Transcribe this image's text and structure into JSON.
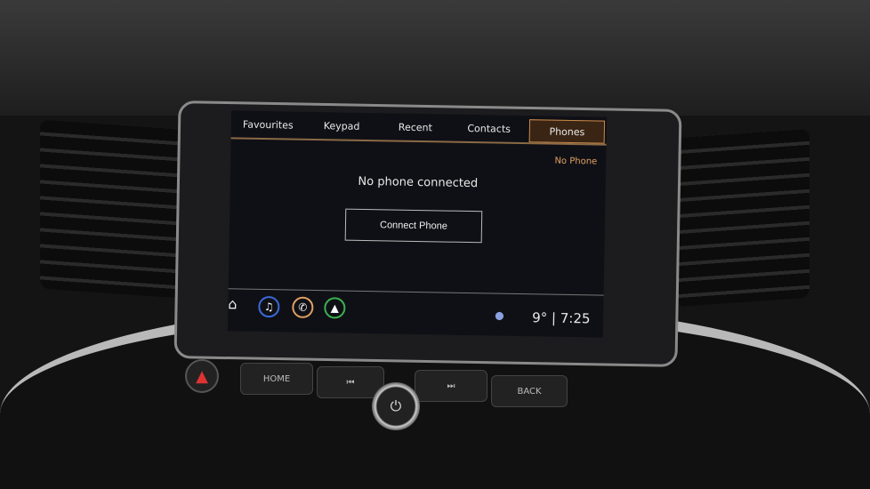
{
  "tabs": [
    {
      "label": "Favourites"
    },
    {
      "label": "Keypad"
    },
    {
      "label": "Recent"
    },
    {
      "label": "Contacts"
    },
    {
      "label": "Phones",
      "active": true
    }
  ],
  "status": "No Phone",
  "message": "No phone connected",
  "connect_button": "Connect Phone",
  "statusbar": {
    "temperature": "9°",
    "time": "7:25"
  },
  "icons": {
    "home": "⌂",
    "music": "♫",
    "phone": "✆",
    "nav": "▲",
    "pin": "⬤"
  },
  "colors": {
    "accent": "#c98a4a",
    "music": "#3a6ad8",
    "phone": "#e0a060",
    "nav": "#3cb050"
  },
  "physical": {
    "home": "HOME",
    "prev": "⏮",
    "next": "⏭",
    "back": "BACK",
    "power": "⏻",
    "hazard": "▲"
  }
}
